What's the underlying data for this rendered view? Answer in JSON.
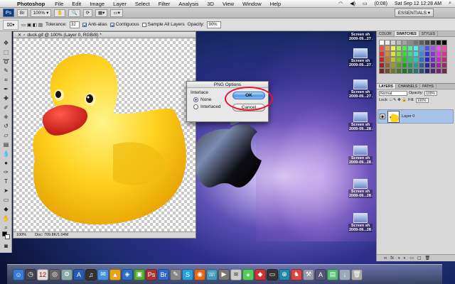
{
  "menubar": {
    "app_name": "Photoshop",
    "menus": [
      "File",
      "Edit",
      "Image",
      "Layer",
      "Select",
      "Filter",
      "Analysis",
      "3D",
      "View",
      "Window",
      "Help"
    ],
    "battery_time": "(0:08)",
    "clock": "Sat Sep 12  12:28 AM"
  },
  "appbar": {
    "logo": "Ps",
    "zoom": "100%",
    "essentials": "ESSENTIALS ▾"
  },
  "options": {
    "tolerance_label": "Tolerance:",
    "tolerance_value": "32",
    "anti_alias": "Anti-alias",
    "contiguous": "Contiguous",
    "sample_all": "Sample All Layers",
    "opacity_label": "Opacity:",
    "opacity_value": "90%"
  },
  "document": {
    "title": "duck.gif @ 100% (Layer 0, RGB/8) *",
    "zoom": "100%",
    "doc_size": "Doc: 709.8K/1.04M"
  },
  "dialog": {
    "title": "PNG Options",
    "group_label": "Interlace",
    "option_none": "None",
    "option_interlaced": "Interlaced",
    "ok": "OK",
    "cancel": "Cancel"
  },
  "desktop_icons": [
    {
      "label": "Screen sh"
    },
    {
      "label": "2009-09...27 AM"
    },
    {
      "label": "Screen sh"
    },
    {
      "label": "2009-09...27 AM"
    },
    {
      "label": "Screen sh"
    },
    {
      "label": "2009-09...27 AM"
    },
    {
      "label": "Screen sh"
    },
    {
      "label": "2009-09...28 AM"
    },
    {
      "label": "Screen sh"
    },
    {
      "label": "2009-09...28 AM"
    },
    {
      "label": "Screen sh"
    },
    {
      "label": "2009-09...28 AM"
    },
    {
      "label": "Screen sh"
    },
    {
      "label": "2009-09...28 AM"
    }
  ],
  "panels": {
    "swatch_tabs": [
      "COLOR",
      "SWATCHES",
      "STYLES"
    ],
    "layer_tabs": [
      "LAYERS",
      "CHANNELS",
      "PATHS"
    ],
    "blend_mode": "Normal",
    "opacity_label": "Opacity:",
    "opacity_value": "100%",
    "lock_label": "Lock:",
    "fill_label": "Fill:",
    "fill_value": "100%",
    "layer_name": "Layer 0"
  },
  "colors": {
    "accent_red": "#e8132e",
    "ok_blue": "#4c97ea",
    "duck_yellow": "#ffd21f"
  }
}
